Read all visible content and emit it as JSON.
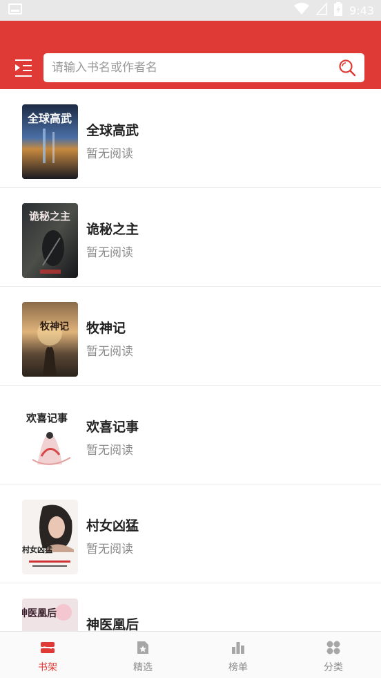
{
  "status_bar": {
    "time": "9:43"
  },
  "search": {
    "placeholder": "请输入书名或作者名"
  },
  "books": [
    {
      "title": "全球高武",
      "progress": "暂无阅读",
      "cover_text": "全球高武"
    },
    {
      "title": "诡秘之主",
      "progress": "暂无阅读",
      "cover_text": "诡秘之主"
    },
    {
      "title": "牧神记",
      "progress": "暂无阅读",
      "cover_text": "牧神记"
    },
    {
      "title": "欢喜记事",
      "progress": "暂无阅读",
      "cover_text": "欢喜记事"
    },
    {
      "title": "村女凶猛",
      "progress": "暂无阅读",
      "cover_text": "村女凶猛"
    },
    {
      "title": "神医凰后",
      "progress": "",
      "cover_text": "神医凰后"
    }
  ],
  "tabs": [
    {
      "label": "书架",
      "icon": "bookshelf-icon",
      "active": true
    },
    {
      "label": "精选",
      "icon": "featured-icon",
      "active": false
    },
    {
      "label": "榜单",
      "icon": "ranking-icon",
      "active": false
    },
    {
      "label": "分类",
      "icon": "category-icon",
      "active": false
    }
  ],
  "colors": {
    "accent": "#df3a35",
    "status_bar": "#e8e8e8",
    "inactive_tab": "#8a8a8a"
  }
}
